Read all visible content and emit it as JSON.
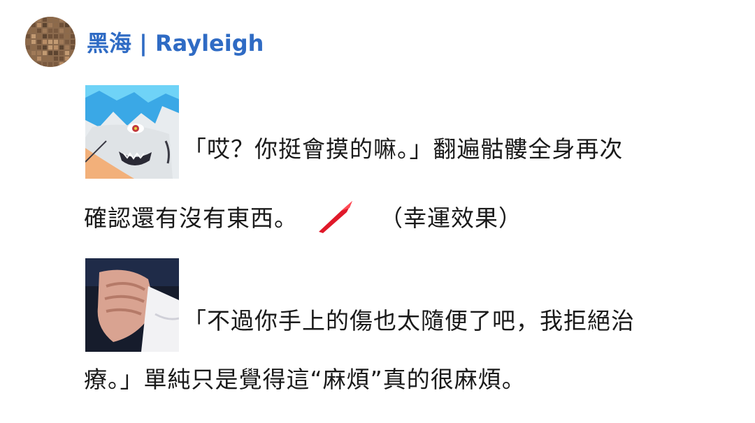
{
  "header": {
    "username": "黑海 | Rayleigh",
    "avatar_icon": "mosaic-avatar"
  },
  "post": {
    "block1": {
      "image_icon": "blue-haired-character-portrait",
      "line1": "「哎？你挺會摸的嘛。」翻遍骷髏全身再次",
      "line2a": "確認還有沒有東西。",
      "marker_icon": "red-brush-stroke-icon",
      "line2b": "（幸運效果）"
    },
    "block2": {
      "image_icon": "clasped-hand-photo",
      "line1": "「不過你手上的傷也太隨便了吧，我拒絕治",
      "line2": "療。」單純只是覺得這“麻煩”真的很麻煩。"
    }
  },
  "colors": {
    "username": "#2f6bc4",
    "text": "#1a1a1a",
    "marker": "#e0192a"
  }
}
